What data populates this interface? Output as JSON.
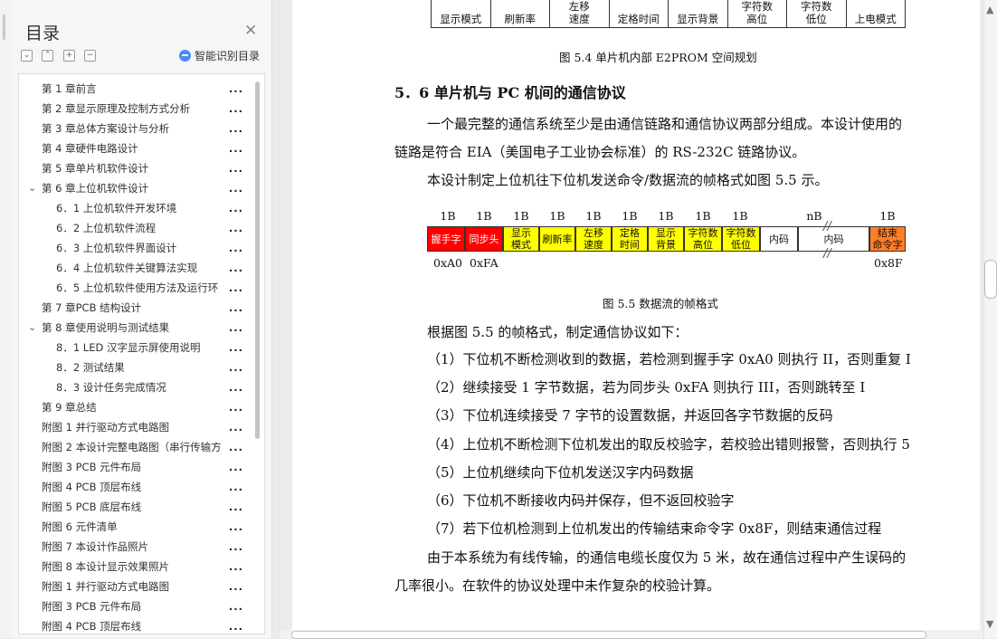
{
  "toc": {
    "title": "目录",
    "smart_label": "智能识别目录",
    "items": [
      {
        "text": "第 1 章前言",
        "level": 0,
        "expand": ""
      },
      {
        "text": "第 2 章显示原理及控制方式分析",
        "level": 0,
        "expand": ""
      },
      {
        "text": "第 3 章总体方案设计与分析",
        "level": 0,
        "expand": ""
      },
      {
        "text": "第 4 章硬件电路设计",
        "level": 0,
        "expand": ""
      },
      {
        "text": "第 5 章单片机软件设计",
        "level": 0,
        "expand": ""
      },
      {
        "text": "第 6 章上位机软件设计",
        "level": 0,
        "expand": "v"
      },
      {
        "text": "6．1  上位机软件开发环境",
        "level": 1,
        "expand": ""
      },
      {
        "text": "6．2  上位机软件流程",
        "level": 1,
        "expand": ""
      },
      {
        "text": "6．3  上位机软件界面设计",
        "level": 1,
        "expand": ""
      },
      {
        "text": "6．4  上位机软件关键算法实现",
        "level": 1,
        "expand": ""
      },
      {
        "text": "6．5  上位机软件使用方法及运行环",
        "level": 1,
        "expand": ""
      },
      {
        "text": "第 7 章PCB 结构设计",
        "level": 0,
        "expand": ""
      },
      {
        "text": "第 8 章使用说明与测试结果",
        "level": 0,
        "expand": "v"
      },
      {
        "text": "8．1    LED 汉字显示屏使用说明",
        "level": 1,
        "expand": ""
      },
      {
        "text": "8．2  测试结果",
        "level": 1,
        "expand": ""
      },
      {
        "text": "8．3  设计任务完成情况",
        "level": 1,
        "expand": ""
      },
      {
        "text": "第 9 章总结",
        "level": 0,
        "expand": ""
      },
      {
        "text": "附图 1  并行驱动方式电路图",
        "level": 0,
        "expand": ""
      },
      {
        "text": "附图 2  本设计完整电路图（串行传输方",
        "level": 0,
        "expand": ""
      },
      {
        "text": "附图 3    PCB 元件布局",
        "level": 0,
        "expand": ""
      },
      {
        "text": "附图 4    PCB 顶层布线",
        "level": 0,
        "expand": ""
      },
      {
        "text": "附图 5    PCB 底层布线",
        "level": 0,
        "expand": ""
      },
      {
        "text": "附图 6  元件清单",
        "level": 0,
        "expand": ""
      },
      {
        "text": "附图 7  本设计作品照片",
        "level": 0,
        "expand": ""
      },
      {
        "text": "附图 8  本设计显示效果照片",
        "level": 0,
        "expand": ""
      },
      {
        "text": "附图 1    并行驱动方式电路图",
        "level": 0,
        "expand": ""
      },
      {
        "text": "附图 3    PCB 元件布局",
        "level": 0,
        "expand": ""
      },
      {
        "text": "附图 4    PCB 顶层布线",
        "level": 0,
        "expand": ""
      }
    ],
    "dots": "..."
  },
  "doc": {
    "top_table": [
      "显示模式",
      "刷新率",
      "左移\n速度",
      "定格时间",
      "显示背景",
      "字符数\n高位",
      "字符数\n低位",
      "上电模式"
    ],
    "fig54_caption": "图 5.4    单片机内部 E2PROM 空间规划",
    "section_heading": "5．6  单片机与 PC 机间的通信协议",
    "para1_line1": "一个最完整的通信系统至少是由通信链路和通信协议两部分组成。本设计使用的",
    "para1_line2": "链路是符合 EIA（美国电子工业协会标准）的 RS-232C 链路协议。",
    "para2": "本设计制定上位机往下位机发送命令/数据流的帧格式如图 5.5 示。",
    "frame": {
      "byte_labels": [
        "1B",
        "1B",
        "1B",
        "1B",
        "1B",
        "1B",
        "1B",
        "1B",
        "1B",
        "nB",
        "1B"
      ],
      "fields": [
        {
          "label": "握手字",
          "color": "#ff0000"
        },
        {
          "label": "同步头",
          "color": "#ff0000"
        },
        {
          "label": "显示\n模式",
          "color": "#ffff00"
        },
        {
          "label": "刷新率",
          "color": "#ffff00"
        },
        {
          "label": "左移\n速度",
          "color": "#ffff00"
        },
        {
          "label": "定格\n时间",
          "color": "#ffff00"
        },
        {
          "label": "显示\n背景",
          "color": "#ffff00"
        },
        {
          "label": "字符数\n高位",
          "color": "#ffff00"
        },
        {
          "label": "字符数\n低位",
          "color": "#ffff00"
        },
        {
          "label": "内码",
          "color": "#ffffff"
        },
        {
          "label": "内码",
          "color": "#ffffff"
        },
        {
          "label": "结束\n命令字",
          "color": "#ff7f27"
        }
      ],
      "addr_left_1": "0xA0",
      "addr_left_2": "0xFA",
      "addr_right": "0x8F",
      "break_mark": "//"
    },
    "fig55_caption": "图 5.5    数据流的帧格式",
    "para3": "根据图 5.5 的帧格式，制定通信协议如下：",
    "steps": [
      "（1）下位机不断检测收到的数据，若检测到握手字 0xA0 则执行 II，否则重复 I",
      "（2）继续接受 1 字节数据，若为同步头 0xFA 则执行 III，否则跳转至 I",
      "（3）下位机连续接受 7 字节的设置数据，并返回各字节数据的反码",
      "（4）上位机不断检测下位机发出的取反校验字，若校验出错则报警，否则执行 5",
      "（5）上位机继续向下位机发送汉字内码数据",
      "（6）下位机不断接收内码并保存，但不返回校验字",
      "（7）若下位机检测到上位机发出的传输结束命令字 0x8F，则结束通信过程"
    ],
    "para4_line1": "由于本系统为有线传输，的通信电缆长度仅为 5 米，故在通信过程中产生误码的",
    "para4_line2": "几率很小。在软件的协议处理中未作复杂的校验计算。"
  }
}
